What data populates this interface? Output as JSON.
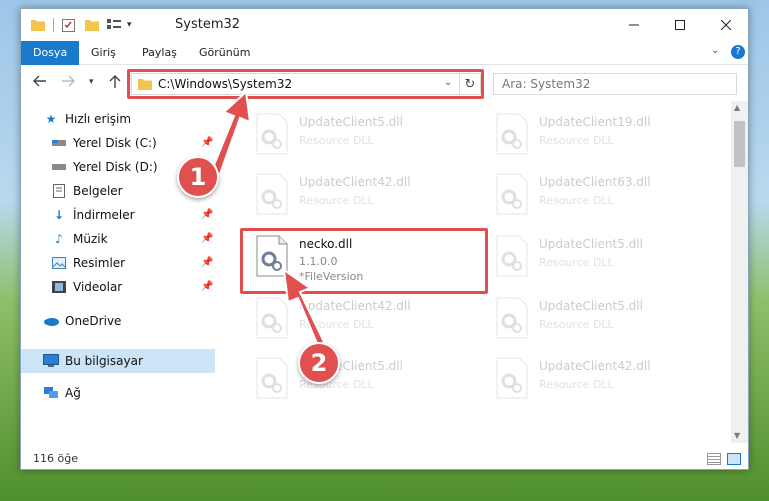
{
  "window": {
    "title": "System32"
  },
  "ribbon": {
    "tabs": [
      "Dosya",
      "Giriş",
      "Paylaş",
      "Görünüm"
    ]
  },
  "address": {
    "path": "C:\\Windows\\System32",
    "search_placeholder": "Ara: System32"
  },
  "nav": {
    "items": [
      {
        "label": "Hızlı erişim",
        "icon": "star-icon"
      },
      {
        "label": "Yerel Disk (C:)",
        "icon": "drive-icon",
        "pinned": true
      },
      {
        "label": "Yerel Disk (D:)",
        "icon": "drive-icon",
        "pinned": true
      },
      {
        "label": "Belgeler",
        "icon": "documents-icon",
        "pinned": true
      },
      {
        "label": "İndirmeler",
        "icon": "download-icon",
        "pinned": true
      },
      {
        "label": "Müzik",
        "icon": "music-icon",
        "pinned": true
      },
      {
        "label": "Resimler",
        "icon": "pictures-icon",
        "pinned": true
      },
      {
        "label": "Videolar",
        "icon": "videos-icon",
        "pinned": true
      },
      {
        "label": "OneDrive",
        "icon": "cloud-icon"
      },
      {
        "label": "Bu bilgisayar",
        "icon": "computer-icon",
        "selected": true
      },
      {
        "label": "Ağ",
        "icon": "network-icon"
      }
    ]
  },
  "files": {
    "left": [
      {
        "name": "UpdateClient5.dll",
        "desc": "Resource DLL"
      },
      {
        "name": "UpdateClient42.dll",
        "desc": "Resource DLL"
      },
      {
        "name": "necko.dll",
        "version": "1.1.0.0",
        "fileversion": "*FileVersion"
      },
      {
        "name": "UpdateClient42.dll",
        "desc": "Resource DLL"
      },
      {
        "name": "UpdateClient5.dll",
        "desc": "Resource DLL"
      }
    ],
    "right": [
      {
        "name": "UpdateClient19.dll",
        "desc": "Resource DLL"
      },
      {
        "name": "UpdateClient63.dll",
        "desc": "Resource DLL"
      },
      {
        "name": "UpdateClient5.dll",
        "desc": "Resource DLL"
      },
      {
        "name": "UpdateClient5.dll",
        "desc": "Resource DLL"
      },
      {
        "name": "UpdateClient42.dll",
        "desc": "Resource DLL"
      }
    ]
  },
  "status": {
    "count": "116 öğe"
  },
  "annotations": {
    "badge1": "1",
    "badge2": "2",
    "accent": "#e0504f"
  }
}
